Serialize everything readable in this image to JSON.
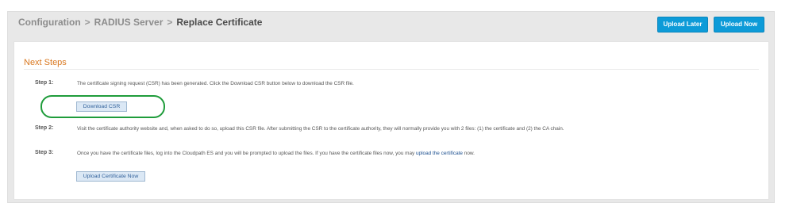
{
  "breadcrumb": {
    "level1": "Configuration",
    "level2": "RADIUS Server",
    "current": "Replace Certificate",
    "separator": ">"
  },
  "header_buttons": {
    "upload_later": "Upload Later",
    "upload_now": "Upload Now"
  },
  "panel": {
    "title": "Next Steps",
    "steps": [
      {
        "label": "Step 1:",
        "text": "The certificate signing request (CSR) has been generated. Click the Download CSR button below to download the CSR file.",
        "button": "Download CSR"
      },
      {
        "label": "Step 2:",
        "text": "Visit the certificate authority website and, when asked to do so, upload this CSR file. After submitting the CSR to the certificate authority, they will normally provide you with 2 files: (1) the certificate and (2) the CA chain."
      },
      {
        "label": "Step 3:",
        "text_before": "Once you have the certificate files, log into the Cloudpath ES and you will be prompted to upload the files. If you have the certificate files now, you may ",
        "link": "upload the certificate",
        "text_after": " now.",
        "button": "Upload Certificate Now"
      }
    ]
  },
  "colors": {
    "primary_button": "#0d9bd8",
    "section_title": "#d9771e",
    "highlight_ring": "#1f9c3b",
    "link": "#1b4f8f"
  }
}
